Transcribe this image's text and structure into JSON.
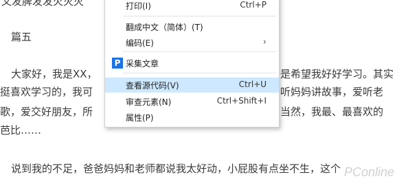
{
  "document": {
    "lines": [
      "又发脾发发火灭灭",
      "篇五",
      "大家好，我是XX，",
      "挺喜欢学习的，我可",
      "歌，爱交好朋友，所",
      "芭比……",
      "说到我的不足，爸爸妈妈和老师都说我太好动，小屁股有点坐不生，这个"
    ],
    "right_fragments": [
      "是希望我好好学习。其实",
      "听妈妈讲故事，爱听老",
      "当然，我最、最喜欢的"
    ]
  },
  "context_menu": {
    "print": {
      "label": "打印(I)",
      "shortcut": "Ctrl+P"
    },
    "translate": {
      "label": "翻成中文（简体）(T)"
    },
    "encoding": {
      "label": "编码(E)",
      "icon": "chevron-right-icon"
    },
    "collect": {
      "label": "采集文章",
      "icon_text": "P"
    },
    "view_source": {
      "label": "查看源代码(V)",
      "shortcut": "Ctrl+U"
    },
    "inspect": {
      "label": "审查元素(N)",
      "shortcut": "Ctrl+Shift+I"
    },
    "properties": {
      "label": "属性(P)"
    },
    "highlight_color": "#cde8ff"
  },
  "watermark": "PConline"
}
